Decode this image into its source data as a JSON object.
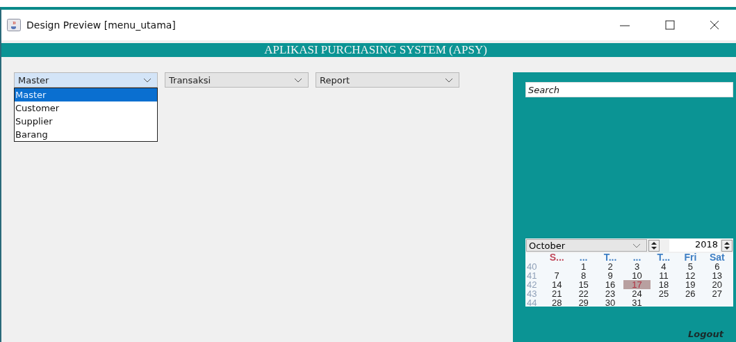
{
  "window": {
    "title": "Design Preview [menu_utama]"
  },
  "header": {
    "title": "APLIKASI PURCHASING SYSTEM (APSY)"
  },
  "menus": [
    {
      "label": "Master",
      "expanded": true,
      "options": [
        {
          "label": "Master",
          "selected": true
        },
        {
          "label": "Customer",
          "selected": false
        },
        {
          "label": "Supplier",
          "selected": false
        },
        {
          "label": "Barang",
          "selected": false
        }
      ]
    },
    {
      "label": "Transaksi",
      "expanded": false
    },
    {
      "label": "Report",
      "expanded": false
    }
  ],
  "search": {
    "placeholder": "Search"
  },
  "calendar": {
    "month": "October",
    "year": "2018",
    "weekdays": [
      {
        "label": "S...",
        "color": "#c0485a"
      },
      {
        "label": "...",
        "color": "#3f7fc4"
      },
      {
        "label": "T...",
        "color": "#3f7fc4"
      },
      {
        "label": "...",
        "color": "#3f7fc4"
      },
      {
        "label": "T...",
        "color": "#3f7fc4"
      },
      {
        "label": "Fri",
        "color": "#3f7fc4"
      },
      {
        "label": "Sat",
        "color": "#3f7fc4"
      }
    ],
    "weeks": [
      {
        "week": "40",
        "days": [
          {
            "day": "1",
            "selected": false
          },
          {
            "day": "2",
            "selected": false
          },
          {
            "day": "3",
            "selected": false
          },
          {
            "day": "4",
            "selected": false
          },
          {
            "day": "5",
            "selected": false
          },
          {
            "day": "6",
            "selected": false
          }
        ]
      },
      {
        "week": "41",
        "days": [
          {
            "day": "7",
            "selected": false
          },
          {
            "day": "8",
            "selected": false
          },
          {
            "day": "9",
            "selected": false
          },
          {
            "day": "10",
            "selected": false
          },
          {
            "day": "11",
            "selected": false
          },
          {
            "day": "12",
            "selected": false
          },
          {
            "day": "13",
            "selected": false
          }
        ]
      },
      {
        "week": "42",
        "days": [
          {
            "day": "14",
            "selected": false
          },
          {
            "day": "15",
            "selected": false
          },
          {
            "day": "16",
            "selected": false
          },
          {
            "day": "17",
            "selected": true
          },
          {
            "day": "18",
            "selected": false
          },
          {
            "day": "19",
            "selected": false
          },
          {
            "day": "20",
            "selected": false
          }
        ]
      },
      {
        "week": "43",
        "days": [
          {
            "day": "21",
            "selected": false
          },
          {
            "day": "22",
            "selected": false
          },
          {
            "day": "23",
            "selected": false
          },
          {
            "day": "24",
            "selected": false
          },
          {
            "day": "25",
            "selected": false
          },
          {
            "day": "26",
            "selected": false
          },
          {
            "day": "27",
            "selected": false
          }
        ]
      },
      {
        "week": "44",
        "days": [
          {
            "day": "28",
            "selected": false
          },
          {
            "day": "29",
            "selected": false
          },
          {
            "day": "30",
            "selected": false
          },
          {
            "day": "31",
            "selected": false
          }
        ]
      }
    ]
  },
  "logout": {
    "label": "Logout"
  }
}
